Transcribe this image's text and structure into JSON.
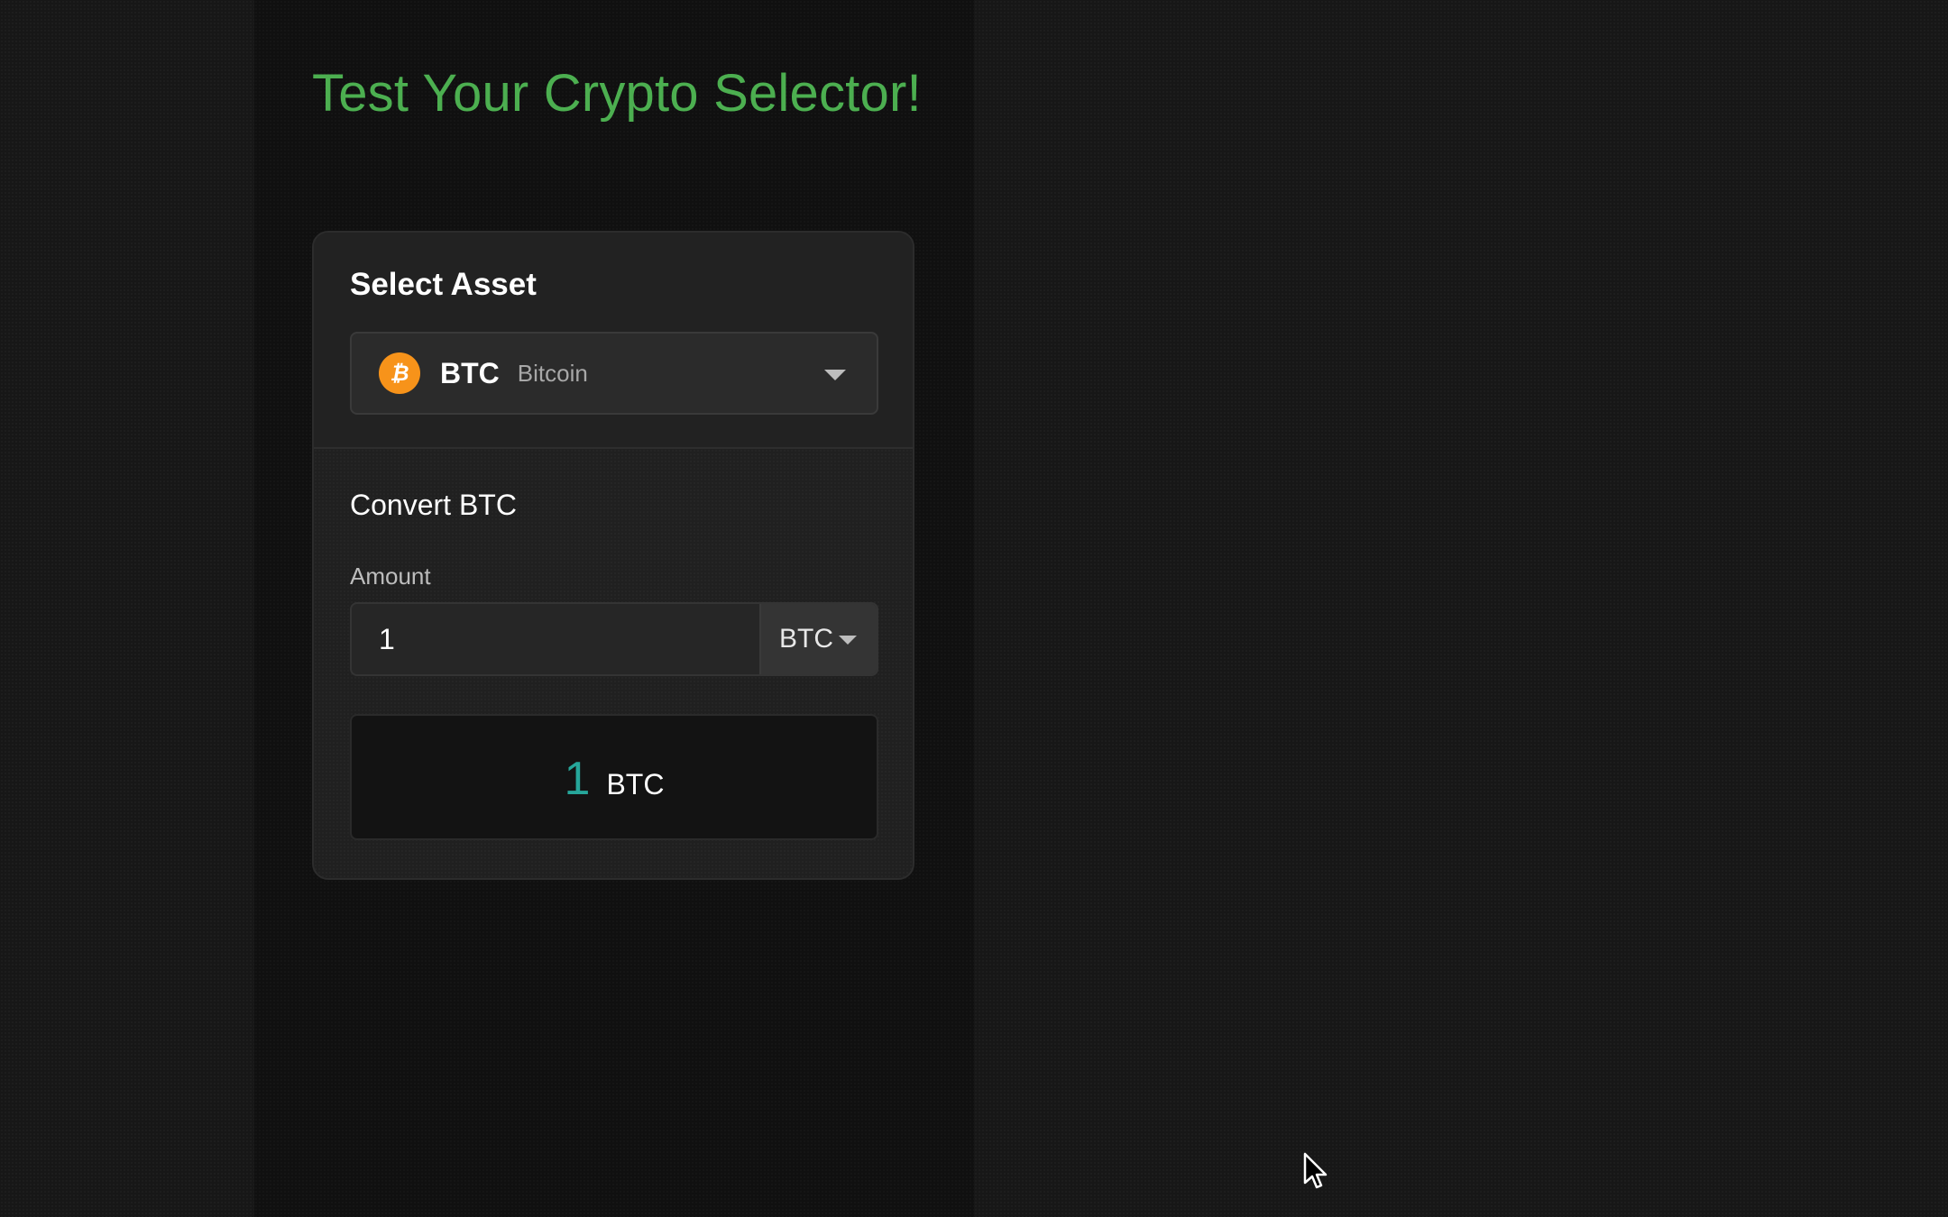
{
  "header": {
    "title": "Test Your Crypto Selector!"
  },
  "asset_selector": {
    "heading": "Select Asset",
    "selected_symbol": "BTC",
    "selected_name": "Bitcoin",
    "icon": "bitcoin-icon",
    "icon_color": "#f7931a"
  },
  "converter": {
    "heading": "Convert BTC",
    "amount_label": "Amount",
    "amount_value": "1",
    "unit_value": "BTC",
    "result_value": "1",
    "result_unit": "BTC"
  },
  "colors": {
    "title": "#4caf50",
    "result_value": "#26a69a",
    "background": "#171717"
  }
}
